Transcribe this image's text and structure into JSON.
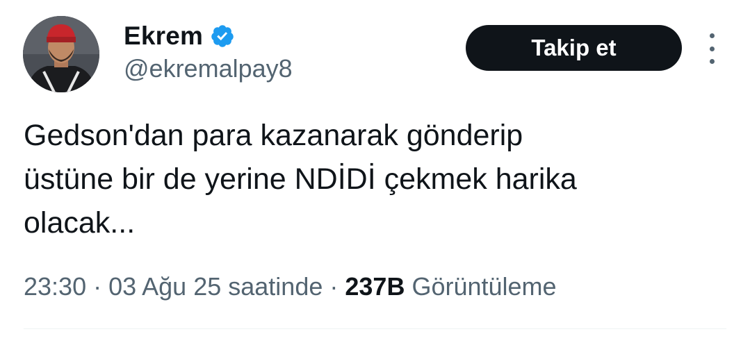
{
  "user": {
    "name": "Ekrem",
    "handle": "@ekremalpay8",
    "verified": true,
    "avatar_icon": "profile-photo"
  },
  "actions": {
    "follow_label": "Takip et",
    "more_icon": "vertical-ellipsis-icon"
  },
  "tweet": {
    "lines": [
      "Gedson'dan para kazanarak gönderip",
      "üstüne bir de yerine NDİDİ çekmek harika",
      "olacak..."
    ]
  },
  "meta": {
    "time": "23:30",
    "sep1": " · ",
    "date": "03 Ağu 25 saatinde",
    "sep2": " · ",
    "views": "237B",
    "views_label": "Görüntüleme"
  },
  "colors": {
    "text_primary": "#0f1419",
    "text_secondary": "#536471",
    "verified_blue": "#1d9bf0",
    "button_bg": "#0f1419"
  }
}
